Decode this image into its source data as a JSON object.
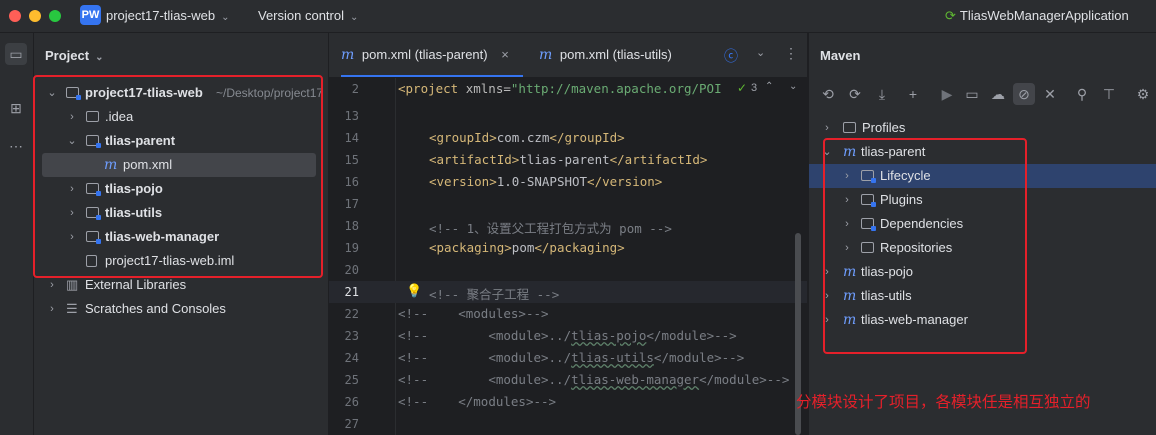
{
  "titlebar": {
    "badge": "PW",
    "project_name": "project17-tlias-web",
    "vcs": "Version control",
    "run_config": "TliasWebManagerApplication"
  },
  "project_panel": {
    "title": "Project",
    "tree": [
      {
        "label": "project17-tlias-web",
        "suffix": "~/Desktop/project17",
        "bold": true
      },
      {
        "label": ".idea"
      },
      {
        "label": "tlias-parent",
        "bold": true
      },
      {
        "label": "pom.xml"
      },
      {
        "label": "tlias-pojo",
        "bold": true
      },
      {
        "label": "tlias-utils",
        "bold": true
      },
      {
        "label": "tlias-web-manager",
        "bold": true
      },
      {
        "label": "project17-tlias-web.iml"
      },
      {
        "label": "External Libraries"
      },
      {
        "label": "Scratches and Consoles"
      }
    ]
  },
  "editor": {
    "tabs": [
      {
        "label": "pom.xml (tlias-parent)",
        "close": "×"
      },
      {
        "label": "pom.xml (tlias-utils)"
      }
    ],
    "inspection_count": "3",
    "lines": [
      "2",
      "13",
      "14",
      "15",
      "16",
      "17",
      "18",
      "19",
      "20",
      "21",
      "22",
      "23",
      "24",
      "25",
      "26",
      "27"
    ],
    "line2_prefix": "<project ",
    "line2_attr": "xmlns=",
    "line2_val": "\"http://maven.apache.org/POI",
    "groupId": "com.czm",
    "artifactId": "tlias-parent",
    "version": "1.0-SNAPSHOT",
    "comment_packaging": "<!-- 1、设置父工程打包方式为 pom -->",
    "packaging": "pom",
    "comment_modules": "<!-- 聚合子工程 -->",
    "mod_prefix": "<!--",
    "mod_open": "<modules>-->",
    "mod_close": "</modules>-->",
    "module_open": "<module>../",
    "module_close": "</module>-->",
    "modules": [
      "tlias-pojo",
      "tlias-utils",
      "tlias-web-manager"
    ]
  },
  "maven": {
    "title": "Maven",
    "tree": [
      {
        "label": "Profiles"
      },
      {
        "label": "tlias-parent"
      },
      {
        "label": "Lifecycle"
      },
      {
        "label": "Plugins"
      },
      {
        "label": "Dependencies"
      },
      {
        "label": "Repositories"
      },
      {
        "label": "tlias-pojo"
      },
      {
        "label": "tlias-utils"
      },
      {
        "label": "tlias-web-manager"
      }
    ]
  },
  "annotation": "分模块设计了项目，各模块任是相互独立的",
  "colors": {
    "accent": "#3574f0",
    "annotation_red": "#e5202a"
  }
}
